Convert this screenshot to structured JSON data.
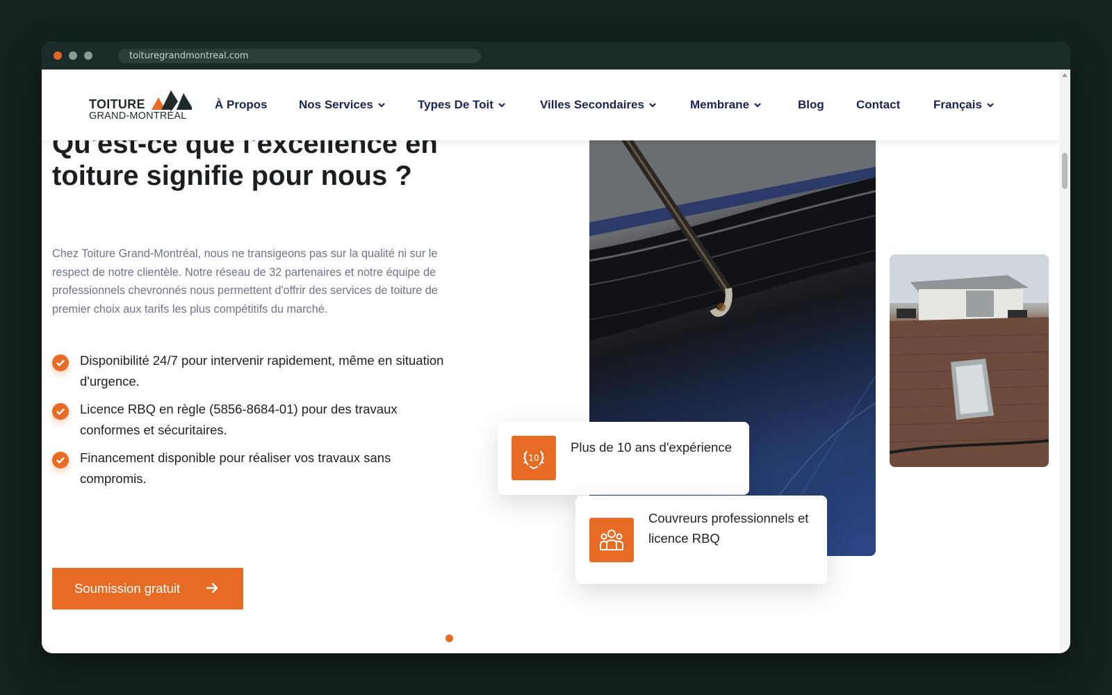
{
  "browser": {
    "url": "toituregrandmontreal.com"
  },
  "header": {
    "logo": {
      "line1": "TOITURE",
      "line2": "GRAND-MONTRÉAL"
    },
    "nav": [
      {
        "label": "À Propos",
        "has_dropdown": false
      },
      {
        "label": "Nos Services",
        "has_dropdown": true
      },
      {
        "label": "Types De Toit",
        "has_dropdown": true
      },
      {
        "label": "Villes Secondaires",
        "has_dropdown": true
      },
      {
        "label": "Membrane",
        "has_dropdown": true
      },
      {
        "label": "Blog",
        "has_dropdown": false
      },
      {
        "label": "Contact",
        "has_dropdown": false
      },
      {
        "label": "Français",
        "has_dropdown": true
      }
    ]
  },
  "main": {
    "heading": "Qu'est-ce que l'excellence en toiture signifie pour nous ?",
    "intro": "Chez Toiture Grand-Montréal, nous ne transigeons pas sur la qualité ni sur le respect de notre clientèle. Notre réseau de 32 partenaires et notre équipe de professionnels chevronnés nous permettent d'offrir des services de toiture de premier choix aux tarifs les plus compétitifs du marché.",
    "features": [
      "Disponibilité 24/7 pour intervenir rapidement, même en situation d'urgence.",
      "Licence RBQ en règle (5856-8684-01) pour des travaux conformes et sécuritaires.",
      "Financement disponible pour réaliser vos travaux sans compromis."
    ],
    "cta_label": "Soumission gratuit",
    "cards": [
      {
        "text": "Plus de 10 ans d'expérience",
        "icon": "ten-years-laurel-icon",
        "badge": "10"
      },
      {
        "text": "Couvreurs professionnels et licence RBQ",
        "icon": "team-icon"
      }
    ]
  },
  "colors": {
    "accent": "#e66c26",
    "nav_text": "#1b2450",
    "heading": "#1b1f22",
    "body_text": "#6f7486",
    "page_bg": "#142320"
  }
}
